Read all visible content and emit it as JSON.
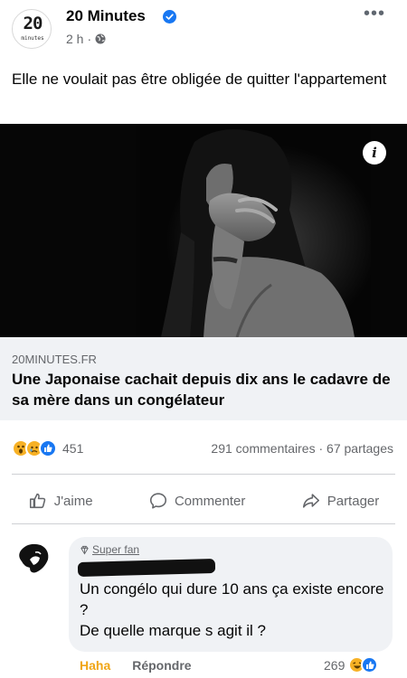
{
  "post": {
    "page_name": "20 Minutes",
    "logo": {
      "number": "20",
      "wordmark": "minutes"
    },
    "time": "2 h",
    "separator": "·",
    "text": "Elle ne voulait pas être obligée de quitter l'appartement",
    "more_icon": "ellipsis-icon"
  },
  "link": {
    "domain": "20MINUTES.FR",
    "title": "Une Japonaise cachait depuis dix ans le cadavre de sa mère dans un congélateur",
    "info_glyph": "i"
  },
  "stats": {
    "reactions": [
      "wow",
      "sad",
      "like"
    ],
    "reaction_count": "451",
    "comments": "291 commentaires",
    "shares": "67 partages",
    "dot": "·"
  },
  "actions": {
    "like": "J'aime",
    "comment": "Commenter",
    "share": "Partager"
  },
  "comment": {
    "badge": "Super fan",
    "text_line1": "Un congélo qui dure 10 ans ça existe encore ?",
    "text_line2": "De quelle marque s agit il ?",
    "haha": "Haha",
    "reply": "Répondre",
    "reaction_count": "269",
    "reactions": [
      "haha",
      "like"
    ]
  },
  "colors": {
    "facebook_blue": "#1877f2",
    "haha_yellow": "#f0a515",
    "secondary_text": "#65676b",
    "card_bg": "#f0f2f5"
  }
}
